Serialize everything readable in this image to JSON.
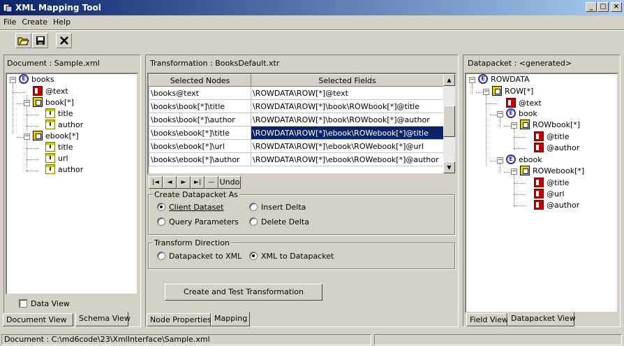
{
  "window": {
    "title": "XML Mapping Tool",
    "min_glyph": "_",
    "max_glyph": "□",
    "close_glyph": "×"
  },
  "menu": [
    "File",
    "Create",
    "Help"
  ],
  "toolbar": {
    "open_icon": "open-folder-icon",
    "save_icon": "save-disk-icon",
    "close_icon": "close-x-icon"
  },
  "left": {
    "header": "Document : Sample.xml",
    "tree": [
      {
        "label": "books",
        "icon": "element-icon"
      },
      {
        "label": "@text",
        "icon": "attribute-icon"
      },
      {
        "label": "book[*]",
        "icon": "row-icon"
      },
      {
        "label": "title",
        "icon": "text-icon"
      },
      {
        "label": "author",
        "icon": "text-icon"
      },
      {
        "label": "ebook[*]",
        "icon": "row-icon"
      },
      {
        "label": "title",
        "icon": "text-icon"
      },
      {
        "label": "url",
        "icon": "text-icon"
      },
      {
        "label": "author",
        "icon": "text-icon"
      }
    ],
    "data_view_label": "Data View",
    "tabs": [
      "Document View",
      "Schema View"
    ]
  },
  "middle": {
    "header": "Transformation : BooksDefault.xtr",
    "columns": [
      "Selected Nodes",
      "Selected Fields"
    ],
    "rows": [
      [
        "\\books@text",
        "\\ROWDATA\\ROW[*]@text"
      ],
      [
        "\\books\\book[*]\\title",
        "\\ROWDATA\\ROW[*]\\book\\ROWbook[*]@title"
      ],
      [
        "\\books\\book[*]\\author",
        "\\ROWDATA\\ROW[*]\\book\\ROWbook[*]@author"
      ],
      [
        "\\books\\ebook[*]\\title",
        "\\ROWDATA\\ROW[*]\\ebook\\ROWebook[*]@title"
      ],
      [
        "\\books\\ebook[*]\\url",
        "\\ROWDATA\\ROW[*]\\ebook\\ROWebook[*]@url"
      ],
      [
        "\\books\\ebook[*]\\author",
        "\\ROWDATA\\ROW[*]\\ebook\\ROWebook[*]@author"
      ]
    ],
    "selected_row": 3,
    "nav": {
      "first": "|◄",
      "prev": "◄",
      "next": "►",
      "last": "►|",
      "delete": "—",
      "undo": "Undo"
    },
    "create_as": {
      "legend": "Create Datapacket As",
      "client_dataset": "Client Dataset",
      "insert_delta": "Insert Delta",
      "query_parameters": "Query Parameters",
      "delete_delta": "Delete Delta",
      "selected": "client_dataset"
    },
    "direction": {
      "legend": "Transform Direction",
      "to_xml": "Datapacket to XML",
      "to_datapacket": "XML to Datapacket",
      "selected": "to_datapacket"
    },
    "create_button": "Create and Test Transformation",
    "tabs": [
      "Node Properties",
      "Mapping"
    ]
  },
  "right": {
    "header": "Datapacket : <generated>",
    "tree": [
      {
        "label": "ROWDATA",
        "icon": "element-icon"
      },
      {
        "label": "ROW[*]",
        "icon": "row-icon"
      },
      {
        "label": "@text",
        "icon": "attribute-icon"
      },
      {
        "label": "book",
        "icon": "element-icon"
      },
      {
        "label": "ROWbook[*]",
        "icon": "row-icon"
      },
      {
        "label": "@title",
        "icon": "attribute-icon"
      },
      {
        "label": "@author",
        "icon": "attribute-icon"
      },
      {
        "label": "ebook",
        "icon": "element-icon"
      },
      {
        "label": "ROWebook[*]",
        "icon": "row-icon"
      },
      {
        "label": "@title",
        "icon": "attribute-icon"
      },
      {
        "label": "@url",
        "icon": "attribute-icon"
      },
      {
        "label": "@author",
        "icon": "attribute-icon"
      }
    ],
    "tabs": [
      "Field View",
      "Datapacket View"
    ]
  },
  "status": {
    "text": "Document : C:\\md6code\\23\\XmlInterface\\Sample.xml"
  }
}
